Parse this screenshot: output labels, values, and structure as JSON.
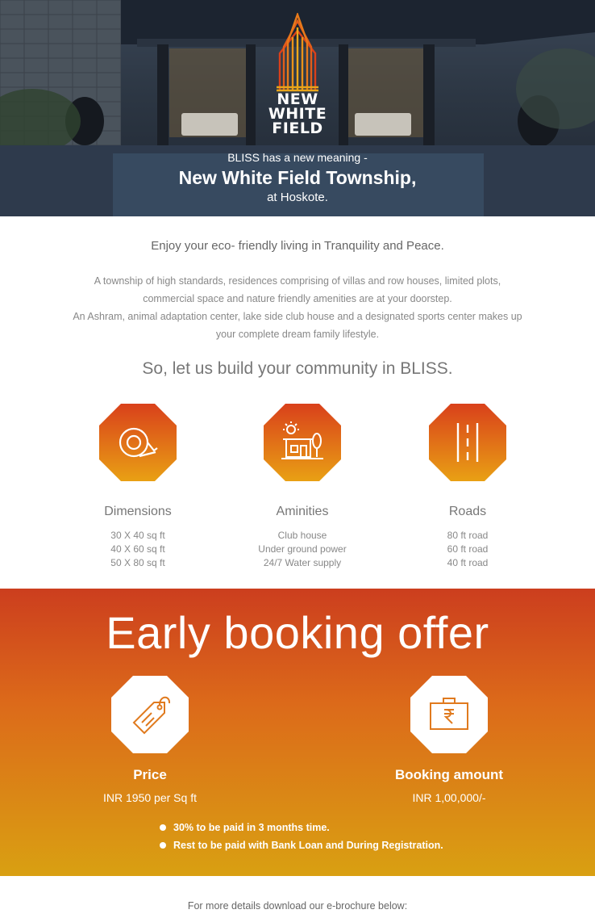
{
  "hero": {
    "logo_line1": "NEW",
    "logo_line2": "WHITE",
    "logo_line3": "FIELD",
    "tagline": "BLISS has a new meaning -",
    "title": "New White Field Township,",
    "subtitle": "at Hoskote."
  },
  "intro": {
    "lead": "Enjoy your eco- friendly living in Tranquility and Peace.",
    "para1": "A township of high standards, residences comprising of villas and row houses, limited plots, commercial space and nature friendly amenities are at your doorstep.",
    "para2": "An Ashram, animal adaptation center, lake side club house and a designated sports center makes up your complete dream family lifestyle.",
    "tagline": "So, let us build your community in BLISS."
  },
  "features": [
    {
      "icon": "measuring-tape-icon",
      "title": "Dimensions",
      "lines": [
        "30 X 40 sq ft",
        "40 X 60 sq ft",
        "50 X 80 sq ft"
      ]
    },
    {
      "icon": "house-amenities-icon",
      "title": "Aminities",
      "lines": [
        "Club house",
        "Under ground power",
        "24/7 Water supply"
      ]
    },
    {
      "icon": "road-icon",
      "title": "Roads",
      "lines": [
        "80 ft road",
        "60 ft road",
        "40 ft road"
      ]
    }
  ],
  "offer": {
    "title": "Early booking offer",
    "price": {
      "icon": "price-tag-icon",
      "title": "Price",
      "value": "INR 1950 per Sq ft"
    },
    "booking": {
      "icon": "rupee-briefcase-icon",
      "title": "Booking amount",
      "value": "INR 1,00,000/-"
    },
    "bullets": [
      "30% to be paid in 3 months time.",
      "Rest to be paid with Bank Loan and During Registration."
    ]
  },
  "footer": {
    "text": "For more details download our e-brochure below:"
  },
  "colors": {
    "accent_top": "#cc3e1e",
    "accent_mid": "#e06a1a",
    "accent_bottom": "#d9a012",
    "hex_icon_top": "#d9401b",
    "hex_icon_bottom": "#e9a014"
  }
}
